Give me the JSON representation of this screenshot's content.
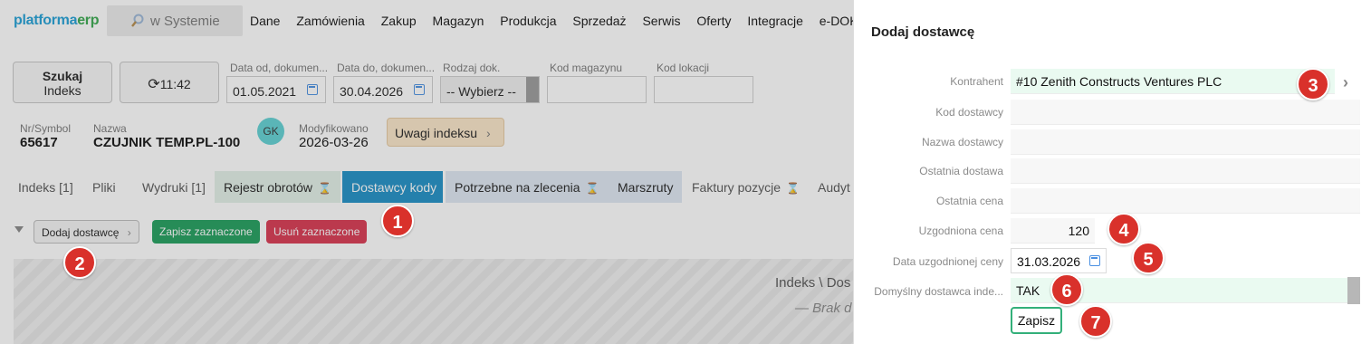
{
  "topbar": {
    "logo_main": "platforma",
    "logo_accent": "erp",
    "search_placeholder": "w Systemie",
    "menu": [
      "Dane",
      "Zamówienia",
      "Zakup",
      "Magazyn",
      "Produkcja",
      "Sprzedaż",
      "Serwis",
      "Oferty",
      "Integracje",
      "e-DOK"
    ]
  },
  "toolbar": {
    "search_line1": "Szukaj",
    "search_line2": "Indeks",
    "refresh_time": "11:42",
    "date_from_label": "Data od, dokumen...",
    "date_from_value": "01.05.2021",
    "date_to_label": "Data do, dokumen...",
    "date_to_value": "30.04.2026",
    "doc_type_label": "Rodzaj dok.",
    "doc_type_value": "-- Wybierz --",
    "warehouse_label": "Kod magazynu",
    "location_label": "Kod lokacji"
  },
  "index_info": {
    "symbol_label": "Nr/Symbol",
    "symbol_value": "65617",
    "name_label": "Nazwa",
    "name_value": "CZUJNIK TEMP.PL-100",
    "avatar": "GK",
    "modified_label": "Modyfikowano",
    "modified_value": "2026-03-26",
    "notes_button": "Uwagi indeksu"
  },
  "tabs": [
    "Indeks [1]",
    "Pliki",
    "Wydruki [1]",
    "Rejestr obrotów",
    "Dostawcy kody",
    "Potrzebne na zlecenia",
    "Marszruty",
    "Faktury pozycje",
    "Audyt"
  ],
  "actions": {
    "add_supplier": "Dodaj dostawcę",
    "save_selected": "Zapisz zaznaczone",
    "delete_selected": "Usuń zaznaczone"
  },
  "grid": {
    "header_fragment": "Indeks \\ Dos",
    "empty_fragment": "— Brak d"
  },
  "drawer": {
    "title": "Dodaj dostawcę",
    "fields": [
      {
        "label": "Kontrahent",
        "value": "#10 Zenith Constructs Ventures PLC"
      },
      {
        "label": "Kod dostawcy",
        "value": ""
      },
      {
        "label": "Nazwa dostawcy",
        "value": ""
      },
      {
        "label": "Ostatnia dostawa",
        "value": ""
      },
      {
        "label": "Ostatnia cena",
        "value": ""
      },
      {
        "label": "Uzgodniona cena",
        "value": "120"
      },
      {
        "label": "Data uzgodnionej ceny",
        "value": "31.03.2026"
      },
      {
        "label": "Domyślny dostawca inde...",
        "value": "TAK"
      }
    ],
    "save_button": "Zapisz"
  },
  "markers": [
    "1",
    "2",
    "3",
    "4",
    "5",
    "6",
    "7"
  ],
  "colors": {
    "accent_blue": "#1d8fc6",
    "save_green": "#1e9e5c",
    "delete_red": "#d9364f",
    "marker_red": "#d9312b"
  }
}
